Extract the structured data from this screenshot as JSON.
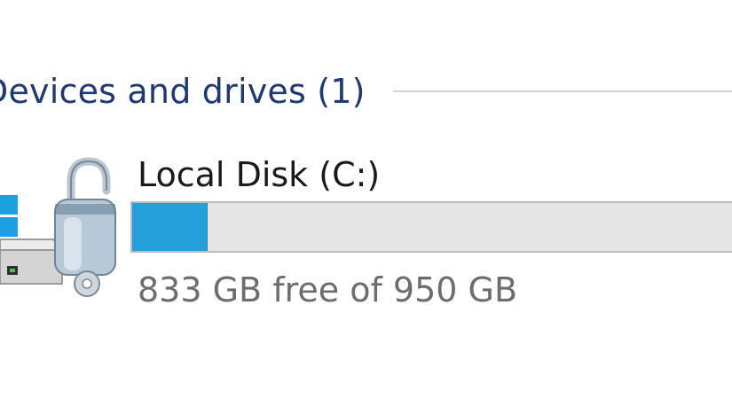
{
  "group": {
    "title": "Devices and drives (1)"
  },
  "drive": {
    "name": "Local Disk (C:)",
    "space_text": "833 GB free of 950 GB",
    "used_fraction": 0.123,
    "icon": "bitlocker-drive-icon",
    "bar_color": "#26a0da"
  }
}
